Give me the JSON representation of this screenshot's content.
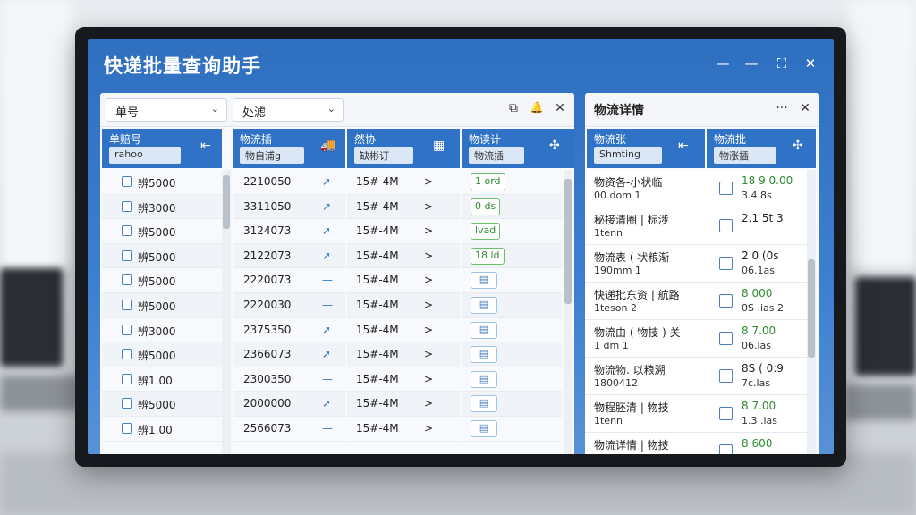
{
  "app": {
    "title": "快递批量查询助手"
  },
  "window_controls": {
    "minimize": "—",
    "restore": "—",
    "fullscreen": "⛶",
    "close": "✕"
  },
  "left_toolbar": {
    "dropdown1": "单号",
    "dropdown2": "处滤",
    "icon1": "⧉",
    "icon2": "🔔",
    "close": "✕"
  },
  "left_columns": [
    {
      "label": "单赔号",
      "filter": "rahoo",
      "icon": "⇤"
    },
    {
      "label": "物流插",
      "filter": "物自浦g",
      "icon": "🚚"
    },
    {
      "label": "然协",
      "filter": "缺彬订",
      "icon": "▦"
    },
    {
      "label": "物读计",
      "filter": "物流插",
      "icon": "✣"
    }
  ],
  "left_rows": [
    {
      "no": "辨5000",
      "code": "2210050",
      "arrow": "➚",
      "time": "15#-4M",
      "gt": ">",
      "status": "1 ord",
      "green": true
    },
    {
      "no": "辨3000",
      "code": "3311050",
      "arrow": "↗",
      "time": "15#-4M",
      "gt": ">",
      "status": "0 ds",
      "green": true
    },
    {
      "no": "辨5000",
      "code": "3124073",
      "arrow": "➚",
      "time": "15#-4M",
      "gt": ">",
      "status": "lvad",
      "green": true
    },
    {
      "no": "辨5000",
      "code": "2122073",
      "arrow": "➚",
      "time": "15#-4M",
      "gt": ">",
      "status": "18 ld",
      "green": true
    },
    {
      "no": "辨5000",
      "code": "2220073",
      "arrow": "—",
      "time": "15#-4M",
      "gt": ">",
      "status": "▤",
      "green": false
    },
    {
      "no": "辨5000",
      "code": "2220030",
      "arrow": "—",
      "time": "15#-4M",
      "gt": ">",
      "status": "▤",
      "green": false
    },
    {
      "no": "辨3000",
      "code": "2375350",
      "arrow": "➚",
      "time": "15#-4M",
      "gt": ">",
      "status": "▤",
      "green": false
    },
    {
      "no": "辨5000",
      "code": "2366073",
      "arrow": "➚",
      "time": "15#-4M",
      "gt": ">",
      "status": "▤",
      "green": false
    },
    {
      "no": "辨1.00",
      "code": "2300350",
      "arrow": "—",
      "time": "15#-4M",
      "gt": ">",
      "status": "▤",
      "green": false
    },
    {
      "no": "辨5000",
      "code": "2000000",
      "arrow": "➚",
      "time": "15#-4M",
      "gt": ">",
      "status": "▤",
      "green": false
    },
    {
      "no": "辨1.00",
      "code": "2566073",
      "arrow": "—",
      "time": "15#-4M",
      "gt": ">",
      "status": "▤",
      "green": false
    }
  ],
  "right_panel": {
    "title": "物流详情",
    "more": "···",
    "close": "✕",
    "columns": [
      {
        "label": "物流张",
        "filter": "Shmting",
        "icon": "⇤"
      },
      {
        "label": "物流批",
        "filter": "物涨插",
        "icon": "✣"
      }
    ],
    "rows": [
      {
        "t1": "物资各-小状临",
        "t2": "00.dom 1",
        "c1": "18 9 0.00",
        "c2": "3.4 8s",
        "green": true
      },
      {
        "t1": "秘接清圈 | 标涉",
        "t2": "1tenn",
        "c1": "2.1 5t 3",
        "c2": "",
        "green": false
      },
      {
        "t1": "物流表 ( 状粮渐",
        "t2": "190mm 1",
        "c1": "2 0 (0s",
        "c2": "06.1as",
        "green": false
      },
      {
        "t1": "快递批东资 | 航路",
        "t2": "1teson 2",
        "c1": "8 000",
        "c2": "0S .ias 2",
        "green": true
      },
      {
        "t1": "物流由 ( 物技 ) 关",
        "t2": "1 dm 1",
        "c1": "8 7.00",
        "c2": "06.las",
        "green": true
      },
      {
        "t1": "物流物. 以粮溯",
        "t2": "1800412",
        "c1": "8S ( 0:9",
        "c2": "7c.las",
        "green": false
      },
      {
        "t1": "物程胚清 | 物技",
        "t2": "1tenn",
        "c1": "8 7.00",
        "c2": "1.3 .las",
        "green": true
      },
      {
        "t1": "物流详情 | 物技",
        "t2": "",
        "c1": "8 600",
        "c2": "",
        "green": true
      }
    ]
  }
}
